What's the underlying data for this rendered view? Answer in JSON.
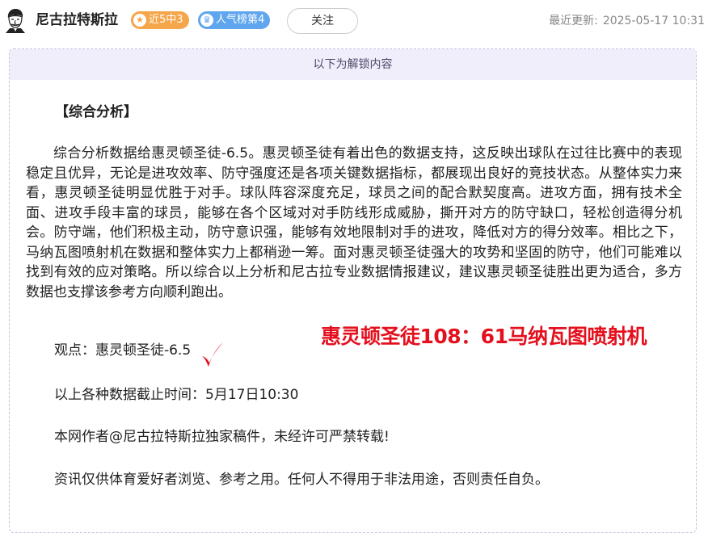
{
  "header": {
    "author_name": "尼古拉特斯拉",
    "badges": [
      {
        "label": "近5中3",
        "icon": "star-icon",
        "color": "#f5a54a"
      },
      {
        "label": "人气榜第4",
        "icon": "crown-icon",
        "color": "#5fa6ee"
      }
    ],
    "follow_label": "关注",
    "update_label": "最近更新:",
    "update_time": "2025-05-17 10:31"
  },
  "content": {
    "unlock_notice": "以下为解锁内容",
    "section_title": "【综合分析】",
    "analysis": "综合分析数据给惠灵顿圣徒-6.5。惠灵顿圣徒有着出色的数据支持，这反映出球队在过往比赛中的表现稳定且优异，无论是进攻效率、防守强度还是各项关键数据指标，都展现出良好的竞技状态。从整体实力来看，惠灵顿圣徒明显优胜于对手。球队阵容深度充足，球员之间的配合默契度高。进攻方面，拥有技术全面、进攻手段丰富的球员，能够在各个区域对对手防线形成威胁，撕开对方的防守缺口，轻松创造得分机会。防守端，他们积极主动，防守意识强，能够有效地限制对手的进攻，降低对方的得分效率。相比之下，马纳瓦图喷射机在数据和整体实力上都稍逊一筹。面对惠灵顿圣徒强大的攻势和坚固的防守，他们可能难以找到有效的应对策略。所以综合以上分析和尼古拉专业数据情报建议，建议惠灵顿圣徒胜出更为适合，多方数据也支撑该参考方向顺利跑出。",
    "opinion": "观点：惠灵顿圣徒-6.5",
    "result_annotation": "惠灵顿圣徒108：61马纳瓦图喷射机",
    "cutoff_time": "以上各种数据截止时间：5月17日10:30",
    "copyright": "本网作者@尼古拉特斯拉独家稿件，未经许可严禁转载!",
    "disclaimer": "资讯仅供体育爱好者浏览、参考之用。任何人不得用于非法用途，否则责任自负。"
  },
  "colors": {
    "accent_red": "#e4101e",
    "unlock_bar_bg": "#f1eefb",
    "dashed_border": "#c9bfe8"
  }
}
